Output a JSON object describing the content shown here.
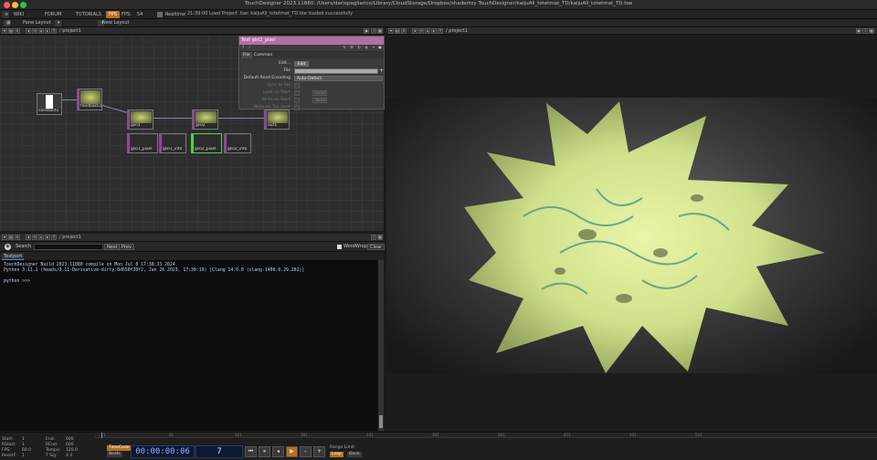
{
  "window": {
    "title": "TouchDesigner 2023.11880: /Users/dariopagliarico/Library/CloudStorage/Dropbox/shadertoy TouchDesigner/kaijuAll_totetmat_TD/kaijuAll_totetmat_TD.toe"
  },
  "menubar": {
    "items": [
      "WIKI",
      "FORUM",
      "TUTORIALS"
    ],
    "fps_badge": "FPS",
    "fps_label": "FPS:",
    "fps_value": "54",
    "realtime": "Realtime",
    "last_message": "21:39:00 Load Project .toe: kaijuAll_totetmat_TD.toe loaded successfully"
  },
  "layout_tabs": [
    "Pane Layout",
    "New Layout"
  ],
  "network": {
    "path": "/ project1",
    "nodes": {
      "constant1": "constant1",
      "feedback1": "feedback1",
      "glsl1": "glsl1",
      "glsl2": "glsl2",
      "out1": "out1",
      "glsl1_pixel": "glsl1_pixel",
      "glsl1_info": "glsl1_info",
      "glsl2_pixel": "glsl2_pixel",
      "glsl2_info": "glsl2_info"
    }
  },
  "param": {
    "header": "Text  glsl2_pixel",
    "tabs": [
      "File",
      "Common"
    ],
    "rows": [
      {
        "label": "Edit...",
        "value": "Edit"
      },
      {
        "label": "File",
        "value": ""
      },
      {
        "label": "Default Read Encoding",
        "value": "Auto-Detect"
      },
      {
        "label": "Sync to File",
        "value": ""
      },
      {
        "label": "Load on Start",
        "value": "Load"
      },
      {
        "label": "Write on Start",
        "value": "Save"
      },
      {
        "label": "Write on Toe Save",
        "value": ""
      }
    ]
  },
  "viewer": {
    "path": "/ project1"
  },
  "textport": {
    "path": "/ project1",
    "search_label": "Search",
    "next": "Next",
    "prev": "Prev",
    "wordwrap": "WordWrap",
    "clear": "Clear",
    "tab": "Textport",
    "lines": [
      "TouchDesigner  Build 2023.11880 compile on Mon Jul  8 17:38:33 2024",
      "Python 3.11.1 (heads/3.11-Derivative-dirty:8d650f30f2, Jan 26 2023, 17:30:19) [Clang 14.0.0 (clang-1400.0.29.202)]",
      "",
      "python >>>"
    ]
  },
  "timeline": {
    "stats": {
      "start": "1",
      "end": "600",
      "rstart": "1",
      "rend": "600",
      "fps": "60.0",
      "tempo": "120.0",
      "resetf": "1",
      "tsig": "4   4"
    },
    "stat_labels": {
      "start": "Start:",
      "end": "End:",
      "rstart": "RStart:",
      "rend": "REnd:",
      "fps": "FPS:",
      "tempo": "Tempo:",
      "resetf": "ResetF:",
      "tsig": "T Sig:"
    },
    "ticks": [
      "1",
      "61",
      "121",
      "181",
      "241",
      "301",
      "361",
      "421",
      "481",
      "541"
    ],
    "timecode_label": "TimeCode",
    "beats_label": "Beats",
    "timecode": "00:00:00:06",
    "frame": "7",
    "range_limit": "Range Limit",
    "loop": "Loop",
    "once": "Once"
  }
}
